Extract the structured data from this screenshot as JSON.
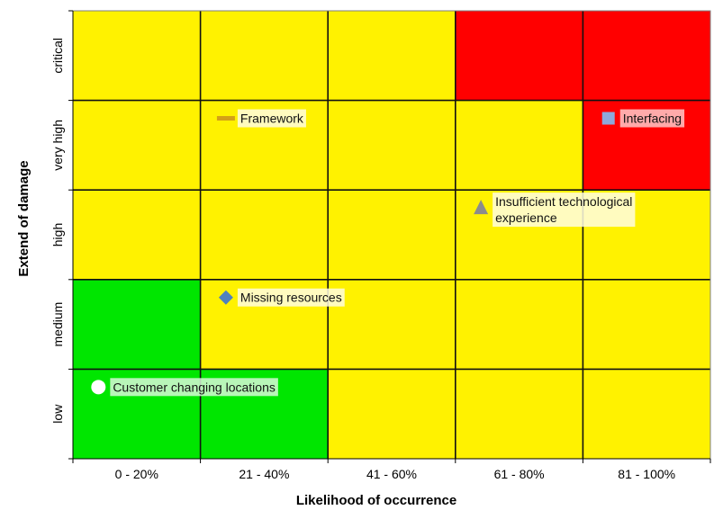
{
  "chart_data": {
    "type": "heatmap",
    "title": "",
    "xlabel": "Likelihood of occurrence",
    "ylabel": "Extend of damage",
    "x_categories": [
      "0 - 20%",
      "21 - 40%",
      "41 - 60%",
      "61 - 80%",
      "81 - 100%"
    ],
    "y_categories": [
      "low",
      "medium",
      "high",
      "very high",
      "critical"
    ],
    "grid": true,
    "colors": {
      "green": "#00e600",
      "yellow": "#fff200",
      "red": "#ff0000"
    },
    "cells": [
      [
        "green",
        "green",
        "yellow",
        "yellow",
        "yellow"
      ],
      [
        "green",
        "yellow",
        "yellow",
        "yellow",
        "yellow"
      ],
      [
        "yellow",
        "yellow",
        "yellow",
        "yellow",
        "yellow"
      ],
      [
        "yellow",
        "yellow",
        "yellow",
        "yellow",
        "red"
      ],
      [
        "yellow",
        "yellow",
        "yellow",
        "red",
        "red"
      ]
    ],
    "points": [
      {
        "name": "Framework",
        "x": 1.2,
        "y": 3.8,
        "marker": "dash",
        "color": "#d4a017",
        "label_bg": "#fffde0"
      },
      {
        "name": "Interfacing",
        "x": 4.2,
        "y": 3.8,
        "marker": "square",
        "color": "#8ea9db",
        "label_bg": "#ffc8c8"
      },
      {
        "name": "Insufficient  technological experience",
        "label_lines": [
          "Insufficient  technological",
          "experience"
        ],
        "x": 3.2,
        "y": 2.8,
        "marker": "triangle",
        "color": "#8c8c8c",
        "label_bg": "#fffde0"
      },
      {
        "name": "Missing resources",
        "x": 1.2,
        "y": 1.8,
        "marker": "diamond",
        "color": "#4f81bd",
        "label_bg": "#fffde0"
      },
      {
        "name": "Customer changing locations",
        "x": 0.2,
        "y": 0.8,
        "marker": "circle",
        "color": "#ffffff",
        "label_bg": "#d8f8d8"
      }
    ]
  }
}
